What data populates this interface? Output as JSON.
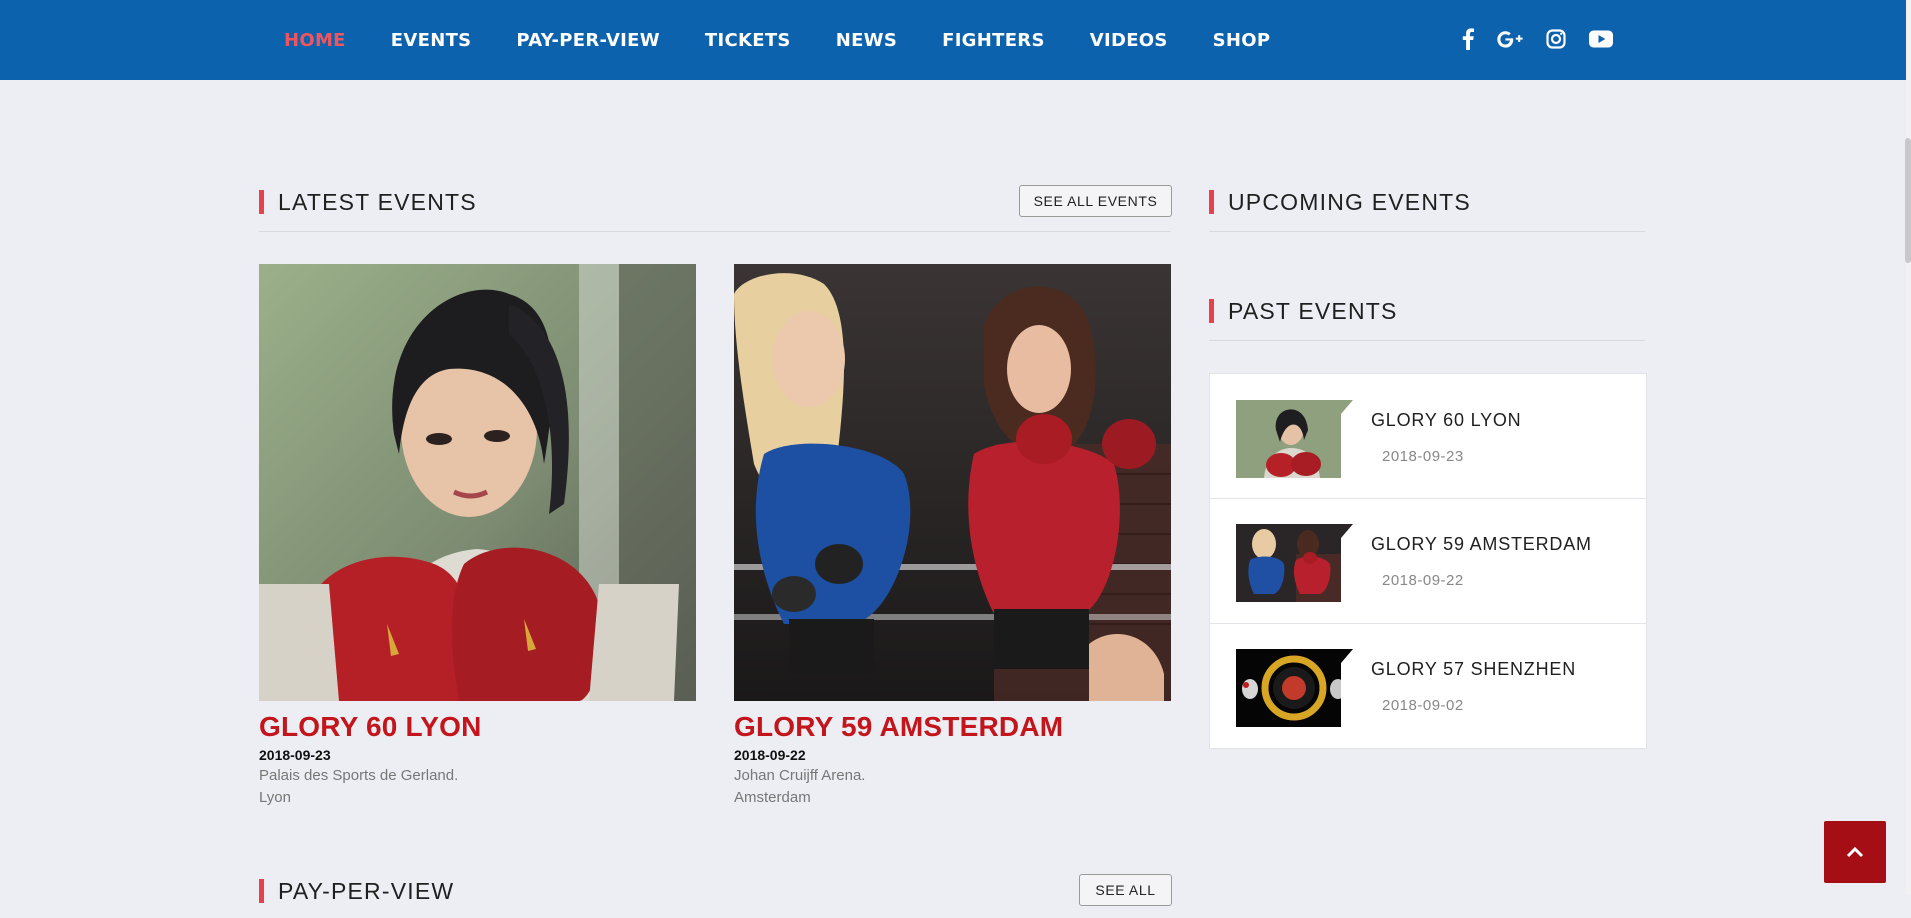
{
  "nav": {
    "items": [
      {
        "label": "HOME",
        "active": true
      },
      {
        "label": "EVENTS",
        "active": false
      },
      {
        "label": "PAY-PER-VIEW",
        "active": false
      },
      {
        "label": "TICKETS",
        "active": false
      },
      {
        "label": "NEWS",
        "active": false
      },
      {
        "label": "FIGHTERS",
        "active": false
      },
      {
        "label": "VIDEOS",
        "active": false
      },
      {
        "label": "SHOP",
        "active": false
      }
    ],
    "social_icons": [
      "facebook-icon",
      "google-plus-icon",
      "instagram-icon",
      "youtube-icon"
    ]
  },
  "colors": {
    "header_bg": "#0d62ad",
    "nav_active": "#f0555f",
    "accent_bar": "#e5424d",
    "event_title": "#c3151c",
    "page_bg": "#edeef3",
    "back_to_top": "#a50e14"
  },
  "latest": {
    "title": "LATEST EVENTS",
    "button": "SEE ALL EVENTS",
    "events": [
      {
        "name": "GLORY 60 LYON",
        "date": "2018-09-23",
        "venue_line1": "Palais des Sports de Gerland.",
        "venue_line2": "Lyon"
      },
      {
        "name": "GLORY 59 AMSTERDAM",
        "date": "2018-09-22",
        "venue_line1": "Johan Cruijff Arena.",
        "venue_line2": "Amsterdam"
      }
    ]
  },
  "upcoming": {
    "title": "UPCOMING EVENTS"
  },
  "past": {
    "title": "PAST EVENTS",
    "items": [
      {
        "name": "GLORY 60 LYON",
        "date": "2018-09-23"
      },
      {
        "name": "GLORY 59 AMSTERDAM",
        "date": "2018-09-22"
      },
      {
        "name": "GLORY 57 SHENZHEN",
        "date": "2018-09-02"
      }
    ]
  },
  "ppv": {
    "title": "PAY-PER-VIEW",
    "button": "SEE ALL"
  },
  "back_to_top_icon": "chevron-up-icon"
}
